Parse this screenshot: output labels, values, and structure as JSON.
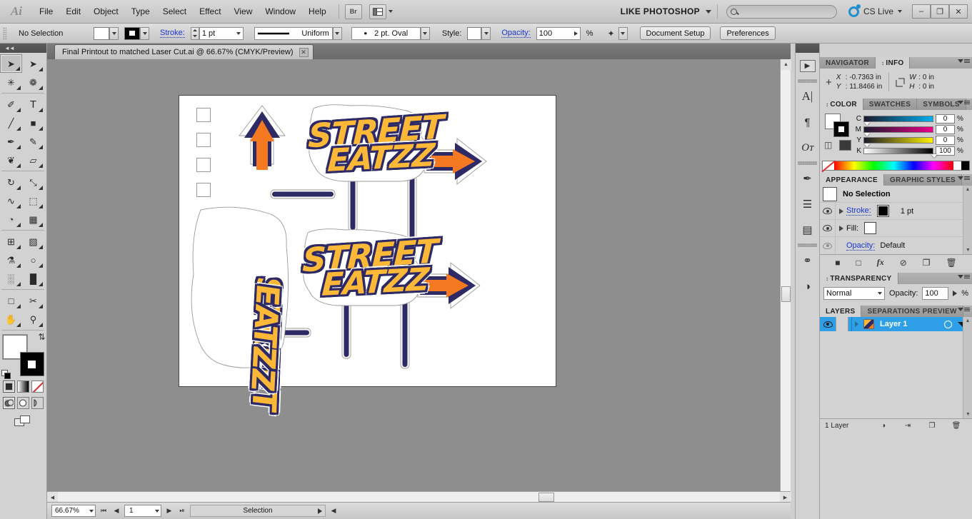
{
  "app": {
    "name": "Adobe Illustrator",
    "logo_text": "Ai"
  },
  "menubar": {
    "items": [
      "File",
      "Edit",
      "Object",
      "Type",
      "Select",
      "Effect",
      "View",
      "Window",
      "Help"
    ],
    "bridge_label": "Br",
    "arrange_icon": "arrange-documents-icon",
    "workspace_label": "LIKE PHOTOSHOP",
    "search_placeholder": "",
    "cslive_label": "CS Live",
    "window_buttons": [
      "–",
      "❐",
      "✕"
    ]
  },
  "controlbar": {
    "selection_label": "No Selection",
    "stroke_label": "Stroke:",
    "stroke_weight": "1 pt",
    "profile_label": "Uniform",
    "brush_label": "2 pt. Oval",
    "style_label": "Style:",
    "opacity_label": "Opacity:",
    "opacity_value": "100",
    "percent": "%",
    "document_setup_label": "Document Setup",
    "preferences_label": "Preferences"
  },
  "document": {
    "tab_title": "Final Printout to matched Laser Cut.ai @ 66.67% (CMYK/Preview)",
    "close_glyph": "✕"
  },
  "toolbar": {
    "tools": [
      {
        "name": "selection-tool",
        "glyph": "➤",
        "selected": true
      },
      {
        "name": "direct-selection-tool",
        "glyph": "➤",
        "selected": false
      },
      {
        "name": "magic-wand-tool",
        "glyph": "✳",
        "selected": false
      },
      {
        "name": "lasso-tool",
        "glyph": "❁",
        "selected": false
      },
      {
        "name": "pen-tool",
        "glyph": "✐",
        "selected": false
      },
      {
        "name": "type-tool",
        "glyph": "T",
        "selected": false
      },
      {
        "name": "line-segment-tool",
        "glyph": "╱",
        "selected": false
      },
      {
        "name": "rectangle-tool",
        "glyph": "■",
        "selected": false
      },
      {
        "name": "paintbrush-tool",
        "glyph": "✒",
        "selected": false
      },
      {
        "name": "pencil-tool",
        "glyph": "✎",
        "selected": false
      },
      {
        "name": "blob-brush-tool",
        "glyph": "❦",
        "selected": false
      },
      {
        "name": "eraser-tool",
        "glyph": "▱",
        "selected": false
      },
      {
        "name": "rotate-tool",
        "glyph": "↻",
        "selected": false
      },
      {
        "name": "scale-tool",
        "glyph": "⤡",
        "selected": false
      },
      {
        "name": "width-tool",
        "glyph": "∿",
        "selected": false
      },
      {
        "name": "free-transform-tool",
        "glyph": "⬚",
        "selected": false
      },
      {
        "name": "shape-builder-tool",
        "glyph": "◔",
        "selected": false
      },
      {
        "name": "perspective-grid-tool",
        "glyph": "▦",
        "selected": false
      },
      {
        "name": "mesh-tool",
        "glyph": "⊞",
        "selected": false
      },
      {
        "name": "gradient-tool",
        "glyph": "▧",
        "selected": false
      },
      {
        "name": "eyedropper-tool",
        "glyph": "⚗",
        "selected": false
      },
      {
        "name": "blend-tool",
        "glyph": "○",
        "selected": false
      },
      {
        "name": "symbol-sprayer-tool",
        "glyph": "░",
        "selected": false
      },
      {
        "name": "column-graph-tool",
        "glyph": "█",
        "selected": false
      },
      {
        "name": "artboard-tool",
        "glyph": "□",
        "selected": false
      },
      {
        "name": "slice-tool",
        "glyph": "✂",
        "selected": false
      },
      {
        "name": "hand-tool",
        "glyph": "✋",
        "selected": false
      },
      {
        "name": "zoom-tool",
        "glyph": "⚲",
        "selected": false
      }
    ],
    "fill_color": "#ffffff",
    "stroke_color": "#000000",
    "swap_glyph": "⇄",
    "mode_buttons": [
      "color-button",
      "gradient-button",
      "none-button"
    ],
    "screen_buttons": [
      "draw-normal",
      "draw-behind",
      "draw-inside"
    ],
    "screenmode_name": "change-screen-mode"
  },
  "navigator_panel": {
    "tabs": [
      {
        "label": "NAVIGATOR",
        "active": false
      },
      {
        "label": "INFO",
        "active": true
      }
    ],
    "info": {
      "x_key": "X",
      "x_value": ": -0.7363 in",
      "y_key": "Y",
      "y_value": ": 11.8466 in",
      "w_key": "W",
      "w_value": ": 0 in",
      "h_key": "H",
      "h_value": ": 0 in"
    }
  },
  "color_panel": {
    "tabs": [
      {
        "label": "COLOR",
        "active": true
      },
      {
        "label": "SWATCHES",
        "active": false
      },
      {
        "label": "SYMBOLS",
        "active": false
      }
    ],
    "fill_color": "#ffffff",
    "stroke_color": "#000000",
    "channels": [
      {
        "label": "C",
        "value": "0",
        "unit": "%",
        "pos": 0,
        "ramp_end": "#00aeef"
      },
      {
        "label": "M",
        "value": "0",
        "unit": "%",
        "pos": 0,
        "ramp_end": "#ec008c"
      },
      {
        "label": "Y",
        "value": "0",
        "unit": "%",
        "pos": 0,
        "ramp_end": "#fff200"
      },
      {
        "label": "K",
        "value": "100",
        "unit": "%",
        "pos": 100,
        "ramp_end": "#000000"
      }
    ]
  },
  "appearance_panel": {
    "tabs": [
      {
        "label": "APPEARANCE",
        "active": true
      },
      {
        "label": "GRAPHIC STYLES",
        "active": false
      }
    ],
    "header_label": "No Selection",
    "rows": [
      {
        "name": "stroke-row",
        "label": "Stroke:",
        "swatch": "#000000",
        "value": "1 pt",
        "link": true
      },
      {
        "name": "fill-row",
        "label": "Fill:",
        "swatch": "#ffffff",
        "value": "",
        "link": false
      },
      {
        "name": "opacity-row",
        "label": "Opacity:",
        "swatch": "",
        "value": "Default",
        "link": true
      }
    ],
    "footer_icons": [
      "add-new-stroke",
      "add-new-fill",
      "add-new-effect",
      "clear-appearance",
      "duplicate-item",
      "delete-item"
    ]
  },
  "transparency_panel": {
    "tabs": [
      {
        "label": "TRANSPARENCY",
        "active": true
      }
    ],
    "blend_mode": "Normal",
    "opacity_label": "Opacity:",
    "opacity_value": "100",
    "percent": "%"
  },
  "layers_panel": {
    "tabs": [
      {
        "label": "LAYERS",
        "active": true
      },
      {
        "label": "SEPARATIONS PREVIEW",
        "active": false
      }
    ],
    "layers": [
      {
        "name": "Layer 1",
        "visible": true,
        "locked": false,
        "color": "#2f9fe8",
        "selected": true
      }
    ],
    "footer_label": "1 Layer",
    "footer_icons": [
      "make-clipping-mask",
      "create-new-sublayer",
      "create-new-layer",
      "delete-selection"
    ]
  },
  "statusbar": {
    "zoom_value": "66.67%",
    "page_value": "1",
    "status_text": "Selection",
    "nav_first": "⏮",
    "nav_prev": "◀",
    "nav_next": "▶",
    "nav_last": "⏭"
  },
  "artwork": {
    "description": "Street Eatzz sign die-cut artwork",
    "colors": {
      "navy": "#2d2a66",
      "orange": "#f47920",
      "yellow": "#fdb838",
      "white": "#ffffff",
      "cut_line": "#9a9a9a"
    },
    "signs": [
      {
        "text": "STREET",
        "sub": "EATZZ",
        "rotation": 0
      },
      {
        "text": "STREET",
        "sub": "EATZZ",
        "rotation": 0
      },
      {
        "text": "STREET",
        "sub": "EATZZ",
        "rotation": 180
      }
    ],
    "registration_marks": 4
  },
  "dockrail": {
    "icons": [
      {
        "name": "navigator-rail-icon",
        "glyph": "▶"
      },
      {
        "name": "character-rail-icon",
        "glyph": "A"
      },
      {
        "name": "paragraph-rail-icon",
        "glyph": "¶"
      },
      {
        "name": "opentype-rail-icon",
        "glyph": "O"
      },
      {
        "name": "brushes-rail-icon",
        "glyph": "✒"
      },
      {
        "name": "align-rail-icon",
        "glyph": "☰"
      },
      {
        "name": "gradient-rail-icon",
        "glyph": "▤"
      },
      {
        "name": "links-rail-icon",
        "glyph": "⚭"
      },
      {
        "name": "image-trace-rail-icon",
        "glyph": "◑"
      }
    ]
  }
}
